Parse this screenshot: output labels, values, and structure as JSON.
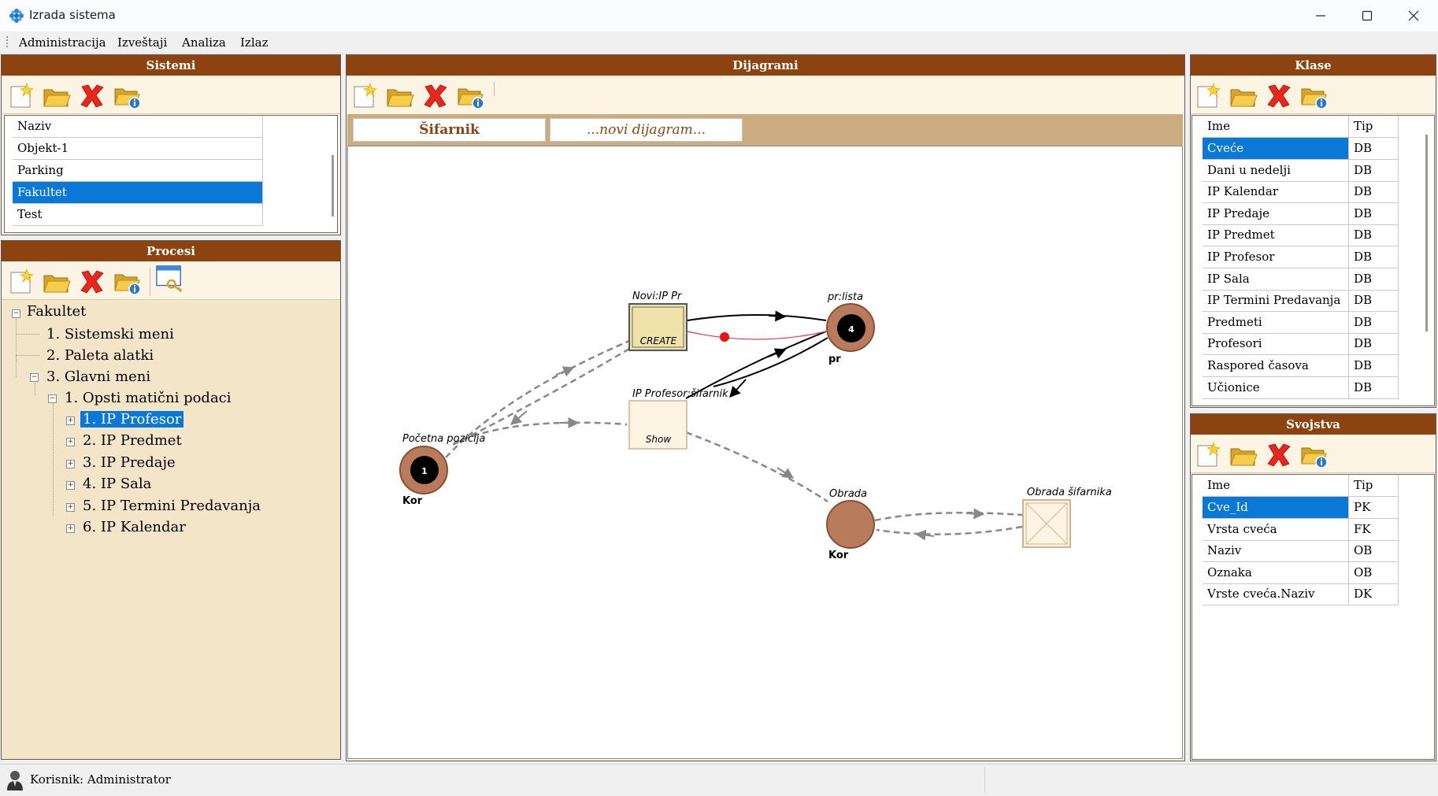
{
  "window": {
    "title": "Izrada sistema"
  },
  "menu": [
    "Administracija",
    "Izveštaji",
    "Analiza",
    "Izlaz"
  ],
  "sistemi": {
    "title": "Sistemi",
    "column": "Naziv",
    "rows": [
      "Objekt-1",
      "Parking",
      "Fakultet",
      "Test"
    ],
    "selected": "Fakultet"
  },
  "procesi": {
    "title": "Procesi",
    "tree": {
      "root": "Fakultet",
      "n1": "1. Sistemski meni",
      "n2": "2. Paleta alatki",
      "n3": "3. Glavni meni",
      "n31": "1. Opsti matični podaci",
      "leaves": [
        "1. IP Profesor",
        "2. IP Predmet",
        "3. IP Predaje",
        "4. IP Sala",
        "5. IP Termini Predavanja",
        "6. IP Kalendar"
      ]
    },
    "selected": "1. IP Profesor"
  },
  "dijagrami": {
    "title": "Dijagrami",
    "tabs": [
      "Šifarnik",
      "...novi dijagram..."
    ],
    "diagram": {
      "node_start_label": "Početna pozicija",
      "node_start_number": "1",
      "node_start_role": "Kor",
      "node_new_label": "Novi:IP Pr",
      "node_new_action": "CREATE",
      "node_list_label": "pr:lista",
      "node_list_number": "4",
      "node_list_role": "pr",
      "node_sifarnik_label": "IP Profesor:šifarnik",
      "node_sifarnik_action": "Show",
      "node_obrada_label": "Obrada",
      "node_obrada_role": "Kor",
      "node_obrada_sif_label": "Obrada šifarnika"
    }
  },
  "klase": {
    "title": "Klase",
    "columns": [
      "Ime",
      "Tip"
    ],
    "rows": [
      [
        "Cveće",
        "DB"
      ],
      [
        "Dani u nedelji",
        "DB"
      ],
      [
        "IP Kalendar",
        "DB"
      ],
      [
        "IP Predaje",
        "DB"
      ],
      [
        "IP Predmet",
        "DB"
      ],
      [
        "IP Profesor",
        "DB"
      ],
      [
        "IP Sala",
        "DB"
      ],
      [
        "IP Termini Predavanja",
        "DB"
      ],
      [
        "Predmeti",
        "DB"
      ],
      [
        "Profesori",
        "DB"
      ],
      [
        "Raspored časova",
        "DB"
      ],
      [
        "Učionice",
        "DB"
      ]
    ],
    "selected": "Cveće"
  },
  "svojstva": {
    "title": "Svojstva",
    "columns": [
      "Ime",
      "Tip"
    ],
    "rows": [
      [
        "Cve_Id",
        "PK"
      ],
      [
        "Vrsta cveća",
        "FK"
      ],
      [
        "Naziv",
        "OB"
      ],
      [
        "Oznaka",
        "OB"
      ],
      [
        "Vrste cveća.Naziv",
        "DK"
      ]
    ],
    "selected": "Cve_Id"
  },
  "status": {
    "user": "Korisnik: Administrator"
  },
  "colors": {
    "header": "#8c4310",
    "panel": "#fdf4e4",
    "tree": "#f3e6c8",
    "selection": "#0a78d7",
    "tabstrip": "#cbab80"
  },
  "icons": [
    "app-icon",
    "new-document-icon",
    "open-folder-icon",
    "delete-icon",
    "folder-info-icon",
    "window-key-icon",
    "user-icon"
  ]
}
